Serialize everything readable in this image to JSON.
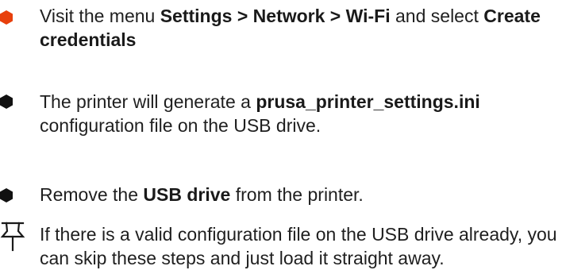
{
  "steps": [
    {
      "parts": [
        {
          "t": "Visit the menu "
        },
        {
          "t": "Settings > Network > Wi-Fi",
          "b": true
        },
        {
          "t": "  and select "
        },
        {
          "t": "Create credentials",
          "b": true
        }
      ],
      "bullet_color": "#e8400c"
    },
    {
      "parts": [
        {
          "t": "The printer will generate a "
        },
        {
          "t": "prusa_printer_settings.ini",
          "b": true
        },
        {
          "t": " configuration file on the USB drive."
        }
      ],
      "bullet_color": "#111111"
    },
    {
      "parts": [
        {
          "t": "Remove the "
        },
        {
          "t": "USB drive",
          "b": true
        },
        {
          "t": " from the printer."
        }
      ],
      "bullet_color": "#111111"
    }
  ],
  "note": {
    "icon": "pushpin-icon",
    "text": "If there is a valid configuration file on the USB drive already, you can skip these steps and just load it straight away."
  }
}
